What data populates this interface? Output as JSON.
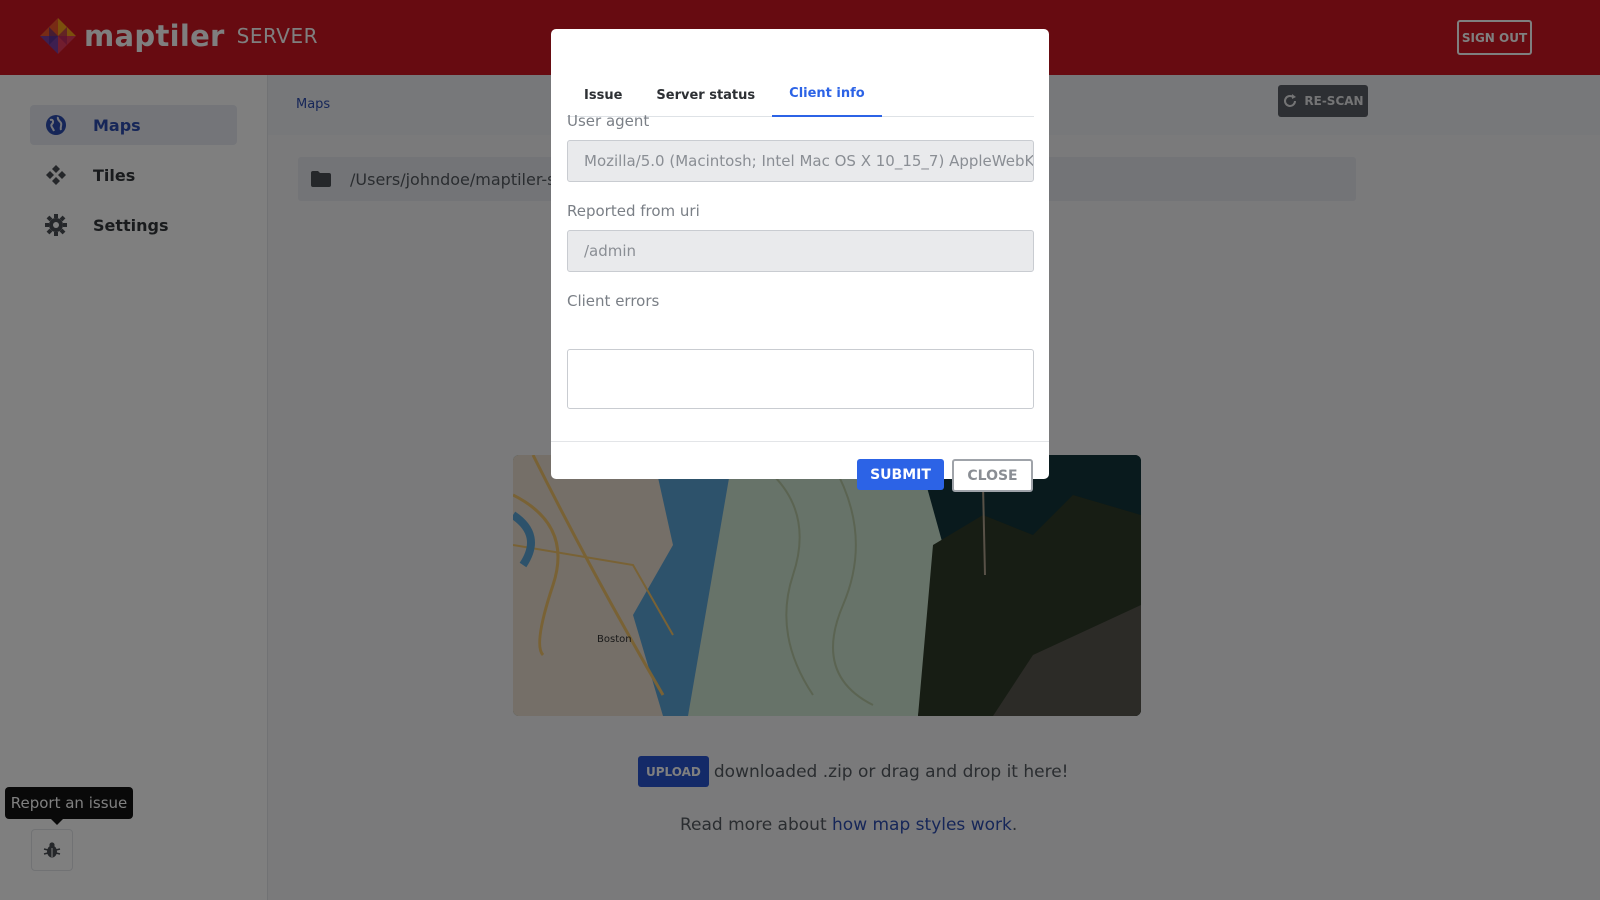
{
  "header": {
    "logo_text": "maptiler",
    "logo_sub": "SERVER",
    "signout_label": "SIGN OUT"
  },
  "sidebar": {
    "items": [
      {
        "label": "Maps",
        "icon": "globe-icon",
        "active": true
      },
      {
        "label": "Tiles",
        "icon": "tiles-icon",
        "active": false
      },
      {
        "label": "Settings",
        "icon": "gear-icon",
        "active": false
      }
    ],
    "tooltip": "Report an issue",
    "bug_icon": "bug-icon"
  },
  "main": {
    "breadcrumb": "Maps",
    "rescan_label": "RE-SCAN",
    "path": "/Users/johndoe/maptiler-se",
    "upload_label": "UPLOAD",
    "upload_text": "downloaded .zip or drag and drop it here!",
    "readmore_prefix": "Read more about",
    "readmore_link": "how map styles work",
    "readmore_suffix": ".",
    "map_label": "Boston"
  },
  "modal": {
    "tabs": [
      {
        "label": "Issue",
        "active": false
      },
      {
        "label": "Server status",
        "active": false
      },
      {
        "label": "Client info",
        "active": true
      }
    ],
    "user_agent_label": "User agent",
    "user_agent_value": "Mozilla/5.0 (Macintosh; Intel Mac OS X 10_15_7) AppleWebK",
    "uri_label": "Reported from uri",
    "uri_value": "/admin",
    "errors_label": "Client errors",
    "errors_value": "",
    "submit_label": "SUBMIT",
    "close_label": "CLOSE"
  },
  "colors": {
    "header": "#cf1722",
    "primary": "#2c63e6",
    "upload": "#2954d1"
  }
}
